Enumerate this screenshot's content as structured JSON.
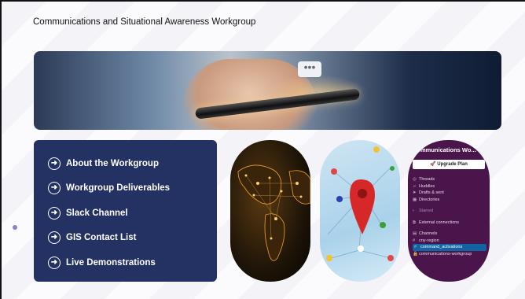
{
  "slide": {
    "title": "Communications and Situational Awareness Workgroup"
  },
  "menu": {
    "items": [
      {
        "label": "About the Workgroup",
        "icon": "arrow-circle-right-icon"
      },
      {
        "label": "Workgroup Deliverables",
        "icon": "arrow-circle-right-icon"
      },
      {
        "label": "Slack Channel",
        "icon": "arrow-circle-right-icon"
      },
      {
        "label": "GIS Contact List",
        "icon": "arrow-circle-right-icon"
      },
      {
        "label": "Live Demonstrations",
        "icon": "arrow-circle-right-icon"
      }
    ]
  },
  "slack": {
    "workspace": "Communications Wo...",
    "upgrade": "Upgrade Plan",
    "nav": [
      "Threads",
      "Huddles",
      "Drafts & sent",
      "Directories"
    ],
    "starred": "Starred",
    "external": "External connections",
    "channels_label": "Channels",
    "channels": [
      "cny-region",
      "command_activations",
      "communications-workgroup"
    ]
  },
  "colors": {
    "menu_bg": "#233163",
    "slack_bg": "#4a154b",
    "accent": "#1164a3"
  }
}
